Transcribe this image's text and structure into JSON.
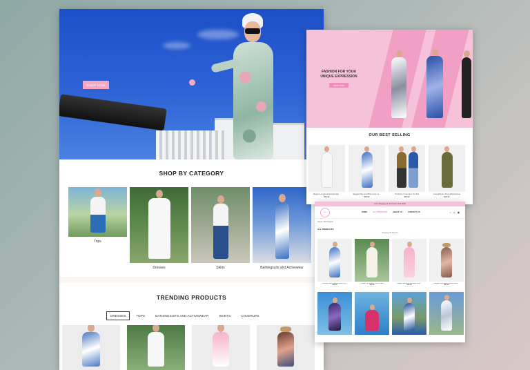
{
  "main_page": {
    "hero": {
      "button_label": "SHOP NOW"
    },
    "shop_by_category": {
      "title": "SHOP BY CATEGORY",
      "categories": [
        {
          "label": "Tops"
        },
        {
          "label": "Dresses"
        },
        {
          "label": "Skirts"
        },
        {
          "label": "Bathingsuits and Activewear"
        }
      ]
    },
    "trending": {
      "title": "TRENDING PRODUCTS",
      "tabs": [
        "DRESSES",
        "TOPS",
        "BATHINGSUITS AND ACTIVEWEAR",
        "SKIRTS",
        "COVERUPS"
      ],
      "active_tab": "DRESSES"
    }
  },
  "second_page": {
    "banner": {
      "headline_line1": "FASHION FOR YOUR",
      "headline_line2": "UNIQUE EXPRESSION",
      "button_label": "SHOP NOW"
    },
    "best_selling": {
      "title": "OUR BEST SELLING",
      "products": [
        {
          "name": "Elegant Long Embroidered High...",
          "price": "$59.99"
        },
        {
          "name": "Elegant Blue And White Knee Le...",
          "price": "$39.99"
        },
        {
          "name": "Tie Button Crown Eye Tie Shirt",
          "price": "$49.99"
        },
        {
          "name": "Casual Button Down Belted Dress",
          "price": "$39.99"
        }
      ]
    }
  },
  "third_page": {
    "promo_bar": "Free Shipping On all Orders Over $99!",
    "logo_text": "Stelle",
    "menu": [
      {
        "label": "HOME",
        "active": false
      },
      {
        "label": "ALL PRODUCTS",
        "active": true
      },
      {
        "label": "ABOUT US",
        "active": false
      },
      {
        "label": "CONTACT US",
        "active": false
      }
    ],
    "breadcrumb": "Home / All Products",
    "title": "ALL PRODUCTS",
    "showing": "Showing 18 Results",
    "products_row1": [
      {
        "name": "Flowing Pattern Belted Button Do...",
        "price": "$59.99",
        "rating": "★★★★★"
      },
      {
        "name": "Flowed Tan Length Tie Fit Dress",
        "price": "$49.99",
        "rating": "★★★★★"
      },
      {
        "name": "Elegant Belted Pink Design Strip...",
        "price": "$59.99",
        "rating": "★★★★★"
      },
      {
        "name": "Elegant Asymmetric Belted Acces...",
        "price": "$59.99",
        "rating": "★★★★★"
      }
    ]
  },
  "colors": {
    "accent_pink": "#f4a8c4",
    "hero_blue": "#1d4fc8",
    "banner_pink": "#f6c2da"
  }
}
